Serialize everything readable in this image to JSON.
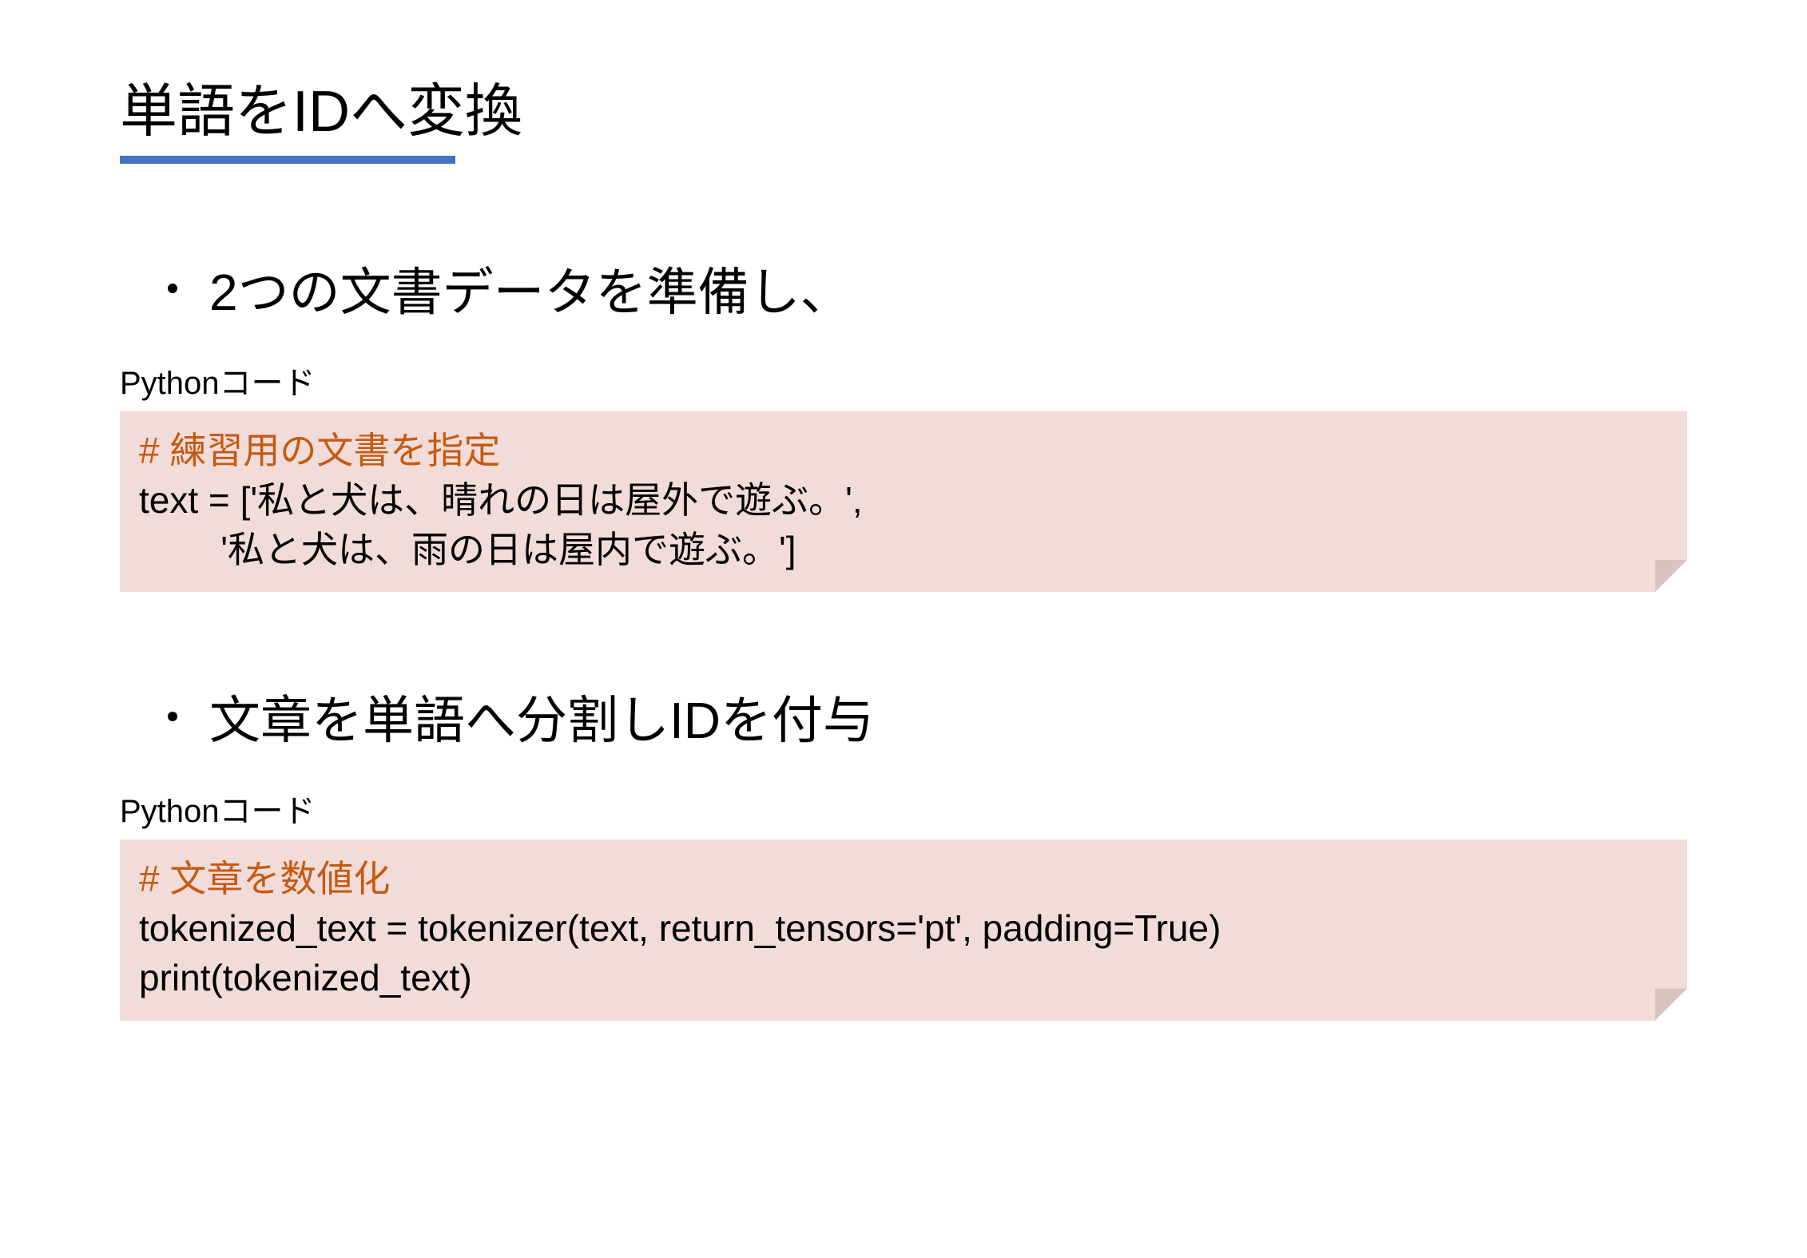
{
  "title": "単語をIDへ変換",
  "bullets": [
    "2つの文書データを準備し、",
    "文章を単語へ分割しIDを付与"
  ],
  "code_label": "Pythonコード",
  "code_blocks": [
    {
      "comment": "# 練習用の文書を指定",
      "lines": [
        "text = ['私と犬は、晴れの日は屋外で遊ぶ。',",
        "        '私と犬は、雨の日は屋内で遊ぶ。']"
      ]
    },
    {
      "comment": "# 文章を数値化",
      "lines": [
        "tokenized_text = tokenizer(text, return_tensors='pt', padding=True)",
        "print(tokenized_text)"
      ]
    }
  ]
}
